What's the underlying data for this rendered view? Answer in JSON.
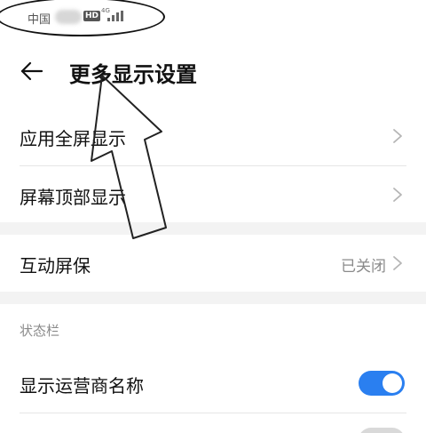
{
  "status_bar": {
    "carrier": "中国",
    "hd_badge": "HD",
    "network_type": "4G"
  },
  "header": {
    "title": "更多显示设置",
    "back_icon": "arrow-left-icon"
  },
  "menu": {
    "items": [
      {
        "label": "应用全屏显示",
        "icon": "chevron-right-icon"
      },
      {
        "label": "屏幕顶部显示",
        "icon": "chevron-right-icon"
      }
    ]
  },
  "screensaver": {
    "label": "互动屏保",
    "value": "已关闭"
  },
  "status_section": {
    "title": "状态栏",
    "items": [
      {
        "label": "显示运营商名称",
        "enabled": true
      },
      {
        "label": "",
        "enabled": false
      }
    ]
  },
  "colors": {
    "accent": "#2a7ff0",
    "background": "#f3f3f3"
  }
}
